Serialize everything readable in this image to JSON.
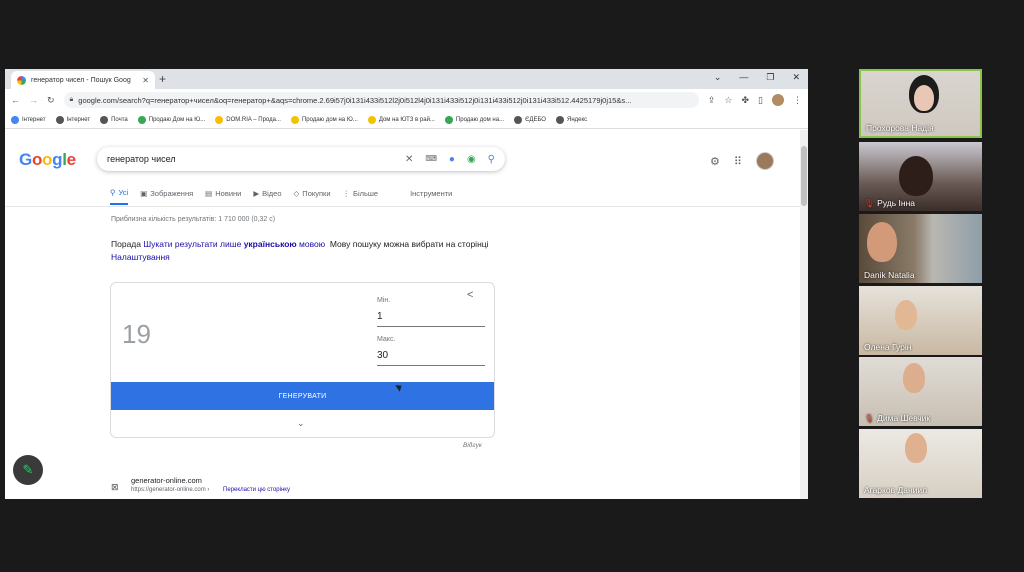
{
  "browser": {
    "tab_title": "генератор чисел - Пошук Goog",
    "tab_close": "✕",
    "new_tab": "+",
    "window_controls": [
      "⌄",
      "—",
      "❐",
      "✕"
    ],
    "address": "google.com/search?q=генератор+чисел&oq=генератор+&aqs=chrome.2.69i57j0i131i433i512l2j0i512l4j0i131i433i512j0i131i433i512j0i131i433i512.4425179j0j15&s...",
    "bookmarks": [
      {
        "label": "Інтернет",
        "color": "#4285f4"
      },
      {
        "label": "Інтернет",
        "color": "#555555"
      },
      {
        "label": "Почта",
        "color": "#555555"
      },
      {
        "label": "Продаю Дом на Ю...",
        "color": "#34a853"
      },
      {
        "label": "DOM.RIA – Прода...",
        "color": "#fbbc05"
      },
      {
        "label": "Продаю дом на Ю...",
        "color": "#f2c300"
      },
      {
        "label": "Дом на ЮТЗ в рай...",
        "color": "#f2c300"
      },
      {
        "label": "Продаю дом на...",
        "color": "#34a853"
      },
      {
        "label": "ЄДЕБО",
        "color": "#555555"
      },
      {
        "label": "Яндекс",
        "color": "#555555"
      }
    ]
  },
  "google": {
    "logo": [
      "G",
      "o",
      "o",
      "g",
      "l",
      "e"
    ],
    "query": "генератор чисел",
    "tabs": [
      {
        "label": "Усі",
        "icon": "search-icon",
        "glyph": "⚲",
        "active": true
      },
      {
        "label": "Зображення",
        "icon": "image-icon",
        "glyph": "▣",
        "active": false
      },
      {
        "label": "Новини",
        "icon": "news-icon",
        "glyph": "▤",
        "active": false
      },
      {
        "label": "Відео",
        "icon": "video-icon",
        "glyph": "▶",
        "active": false
      },
      {
        "label": "Покупки",
        "icon": "tag-icon",
        "glyph": "◇",
        "active": false
      },
      {
        "label": "Більше",
        "icon": "more-icon",
        "glyph": "⋮",
        "active": false
      }
    ],
    "tools_label": "Інструменти",
    "results_count": "Приблизна кількість результатів: 1 710 000 (0,32 с)",
    "tip": {
      "prefix": "Порада",
      "link": "Шукати результати лише",
      "lang": "українською",
      "lang_word": "мовою",
      "rest": "Мову пошуку можна вибрати на сторінці",
      "settings": "Налаштування"
    },
    "rng": {
      "result": "19",
      "min_label": "Мін.",
      "min_value": "1",
      "max_label": "Макс.",
      "max_value": "30",
      "button": "ГЕНЕРУВАТИ"
    },
    "feedback": "Відгук",
    "first_result": {
      "name": "generator-online.com",
      "url": "https://generator-online.com ›",
      "translate": "Перекласти цю сторінку"
    }
  },
  "participants": [
    {
      "name": "Прохорова Надія",
      "muted": false,
      "active": true
    },
    {
      "name": "Рудь Інна",
      "muted": true,
      "active": false
    },
    {
      "name": "Danik Natalia",
      "muted": false,
      "active": false
    },
    {
      "name": "Олена Гурін",
      "muted": false,
      "active": false
    },
    {
      "name": "Дима Шевчик",
      "muted": true,
      "active": false
    },
    {
      "name": "Агарков Даниил",
      "muted": false,
      "active": false
    }
  ]
}
